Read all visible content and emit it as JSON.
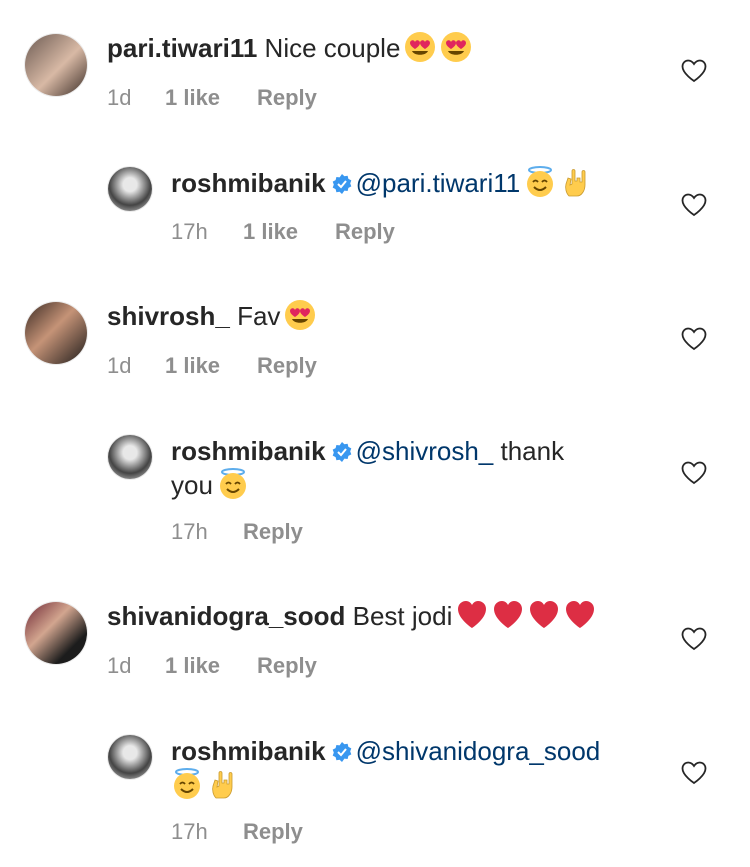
{
  "colors": {
    "text": "#262626",
    "muted": "#8e8e8e",
    "mention": "#00376b",
    "verified": "#3897f0"
  },
  "comments": [
    {
      "username": "pari.tiwari11",
      "text": "Nice couple",
      "emojis": [
        "heart-eyes-emoji",
        "heart-eyes-emoji"
      ],
      "time": "1d",
      "likes": "1 like",
      "reply_label": "Reply"
    },
    {
      "username": "roshmibanik",
      "mention": "@pari.tiwari11",
      "text": "",
      "emojis": [
        "halo-smile-emoji",
        "rock-hand-emoji"
      ],
      "time": "17h",
      "likes": "1 like",
      "reply_label": "Reply"
    },
    {
      "username": "shivrosh_",
      "text": "Fav",
      "emojis": [
        "heart-eyes-emoji"
      ],
      "time": "1d",
      "likes": "1 like",
      "reply_label": "Reply"
    },
    {
      "username": "roshmibanik",
      "mention": "@shivrosh_",
      "text": "thank you",
      "emojis": [
        "halo-smile-emoji"
      ],
      "time": "17h",
      "likes": "",
      "reply_label": "Reply"
    },
    {
      "username": "shivanidogra_sood",
      "text": "Best jodi",
      "emojis": [
        "red-heart-emoji",
        "red-heart-emoji",
        "red-heart-emoji",
        "red-heart-emoji"
      ],
      "time": "1d",
      "likes": "1 like",
      "reply_label": "Reply"
    },
    {
      "username": "roshmibanik",
      "mention": "@shivanidogra_sood",
      "text": "",
      "emojis": [
        "halo-smile-emoji",
        "rock-hand-emoji"
      ],
      "time": "17h",
      "likes": "",
      "reply_label": "Reply"
    }
  ]
}
